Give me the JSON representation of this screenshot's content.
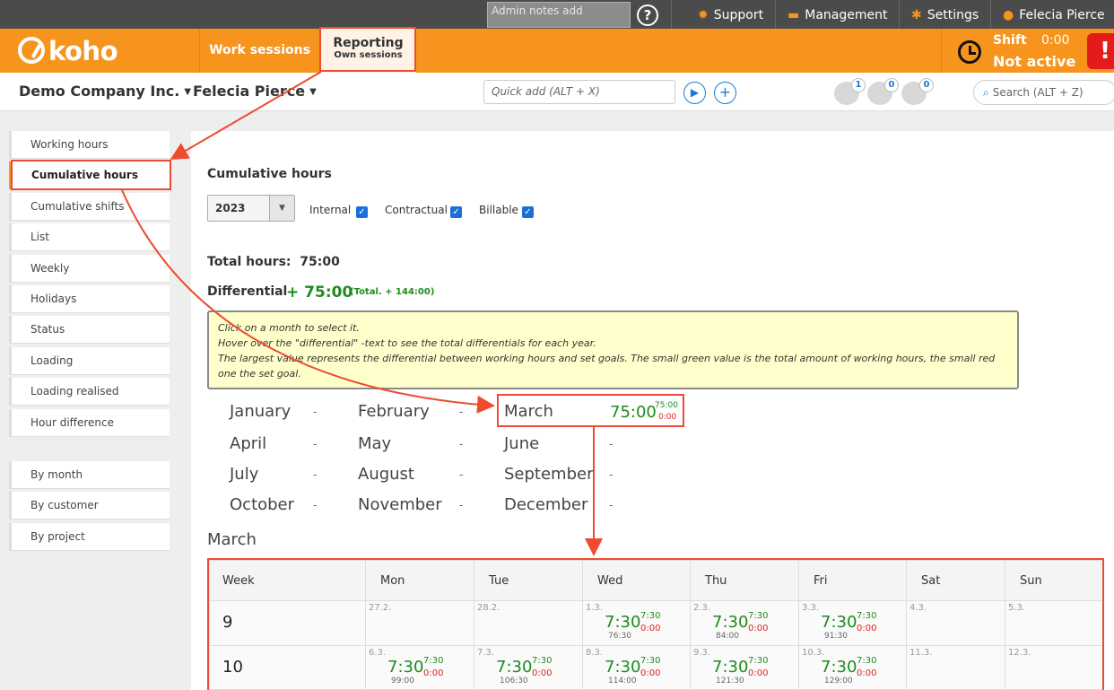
{
  "topbar": {
    "admin_notes_placeholder": "Admin notes add",
    "support": "Support",
    "management": "Management",
    "settings": "Settings",
    "user": "Felecia Pierce",
    "icons": {
      "help": "help-icon",
      "support": "lifebuoy-icon",
      "management": "briefcase-icon",
      "settings": "gear-icon",
      "user": "user-icon"
    }
  },
  "header": {
    "logo": "koho",
    "tabs": [
      {
        "label": "Work sessions",
        "sub": ""
      },
      {
        "label": "Reporting",
        "sub": "Own sessions"
      }
    ],
    "shift_label": "Shift",
    "shift_time": "0:00",
    "shift_status": "Not active",
    "alert_symbol": "!"
  },
  "subbar": {
    "company": "Demo Company Inc.",
    "person": "Felecia Pierce",
    "quickadd_placeholder": "Quick add (ALT + X)",
    "badges": [
      "1",
      "0",
      "0"
    ],
    "search_placeholder": "Search (ALT + Z)"
  },
  "sidebar": {
    "group1": [
      "Working hours",
      "Cumulative hours",
      "Cumulative shifts",
      "List",
      "Weekly",
      "Holidays",
      "Status",
      "Loading",
      "Loading realised",
      "Hour difference"
    ],
    "group2": [
      "By month",
      "By customer",
      "By project"
    ],
    "active": "Cumulative hours"
  },
  "main": {
    "title": "Cumulative hours",
    "year": "2023",
    "checkboxes": [
      {
        "label": "Internal",
        "checked": true
      },
      {
        "label": "Contractual",
        "checked": true
      },
      {
        "label": "Billable",
        "checked": true
      }
    ],
    "total_label": "Total hours:",
    "total_value": "75:00",
    "diff_label": "Differential",
    "diff_value": "+ 75:00",
    "diff_total": "(Total. + 144:00)",
    "note_lines": [
      "Click on a month to select it.",
      "Hover over the \"differential\" -text to see the total differentials for each year.",
      "The largest value represents the differential between working hours and set goals. The small green value is the total amount of working hours, the small red one the set goal."
    ],
    "months": [
      {
        "name": "January",
        "value": "-"
      },
      {
        "name": "February",
        "value": "-"
      },
      {
        "name": "March",
        "value": "75:00",
        "small_green": "75:00",
        "small_red": "0:00"
      },
      {
        "name": "April",
        "value": "-"
      },
      {
        "name": "May",
        "value": "-"
      },
      {
        "name": "June",
        "value": "-"
      },
      {
        "name": "July",
        "value": "-"
      },
      {
        "name": "August",
        "value": "-"
      },
      {
        "name": "September",
        "value": "-"
      },
      {
        "name": "October",
        "value": "-"
      },
      {
        "name": "November",
        "value": "-"
      },
      {
        "name": "December",
        "value": "-"
      }
    ],
    "selected_month": "March",
    "calendar": {
      "headers": [
        "Week",
        "Mon",
        "Tue",
        "Wed",
        "Thu",
        "Fri",
        "Sat",
        "Sun"
      ],
      "rows": [
        {
          "week": "9",
          "days": [
            {
              "date": "27.2."
            },
            {
              "date": "28.2."
            },
            {
              "date": "1.3.",
              "big": "7:30",
              "green": "7:30",
              "red": "0:00",
              "total": "76:30"
            },
            {
              "date": "2.3.",
              "big": "7:30",
              "green": "7:30",
              "red": "0:00",
              "total": "84:00"
            },
            {
              "date": "3.3.",
              "big": "7:30",
              "green": "7:30",
              "red": "0:00",
              "total": "91:30"
            },
            {
              "date": "4.3."
            },
            {
              "date": "5.3."
            }
          ]
        },
        {
          "week": "10",
          "days": [
            {
              "date": "6.3.",
              "big": "7:30",
              "green": "7:30",
              "red": "0:00",
              "total": "99:00"
            },
            {
              "date": "7.3.",
              "big": "7:30",
              "green": "7:30",
              "red": "0:00",
              "total": "106:30"
            },
            {
              "date": "8.3.",
              "big": "7:30",
              "green": "7:30",
              "red": "0:00",
              "total": "114:00"
            },
            {
              "date": "9.3.",
              "big": "7:30",
              "green": "7:30",
              "red": "0:00",
              "total": "121:30"
            },
            {
              "date": "10.3.",
              "big": "7:30",
              "green": "7:30",
              "red": "0:00",
              "total": "129:00"
            },
            {
              "date": "11.3."
            },
            {
              "date": "12.3."
            }
          ]
        }
      ]
    }
  },
  "colors": {
    "brand_orange": "#f7941d",
    "annotation_red": "#ee4b30",
    "positive_green": "#1e8a1e",
    "negative_red": "#dd2222",
    "link_blue": "#1b7bd3"
  }
}
